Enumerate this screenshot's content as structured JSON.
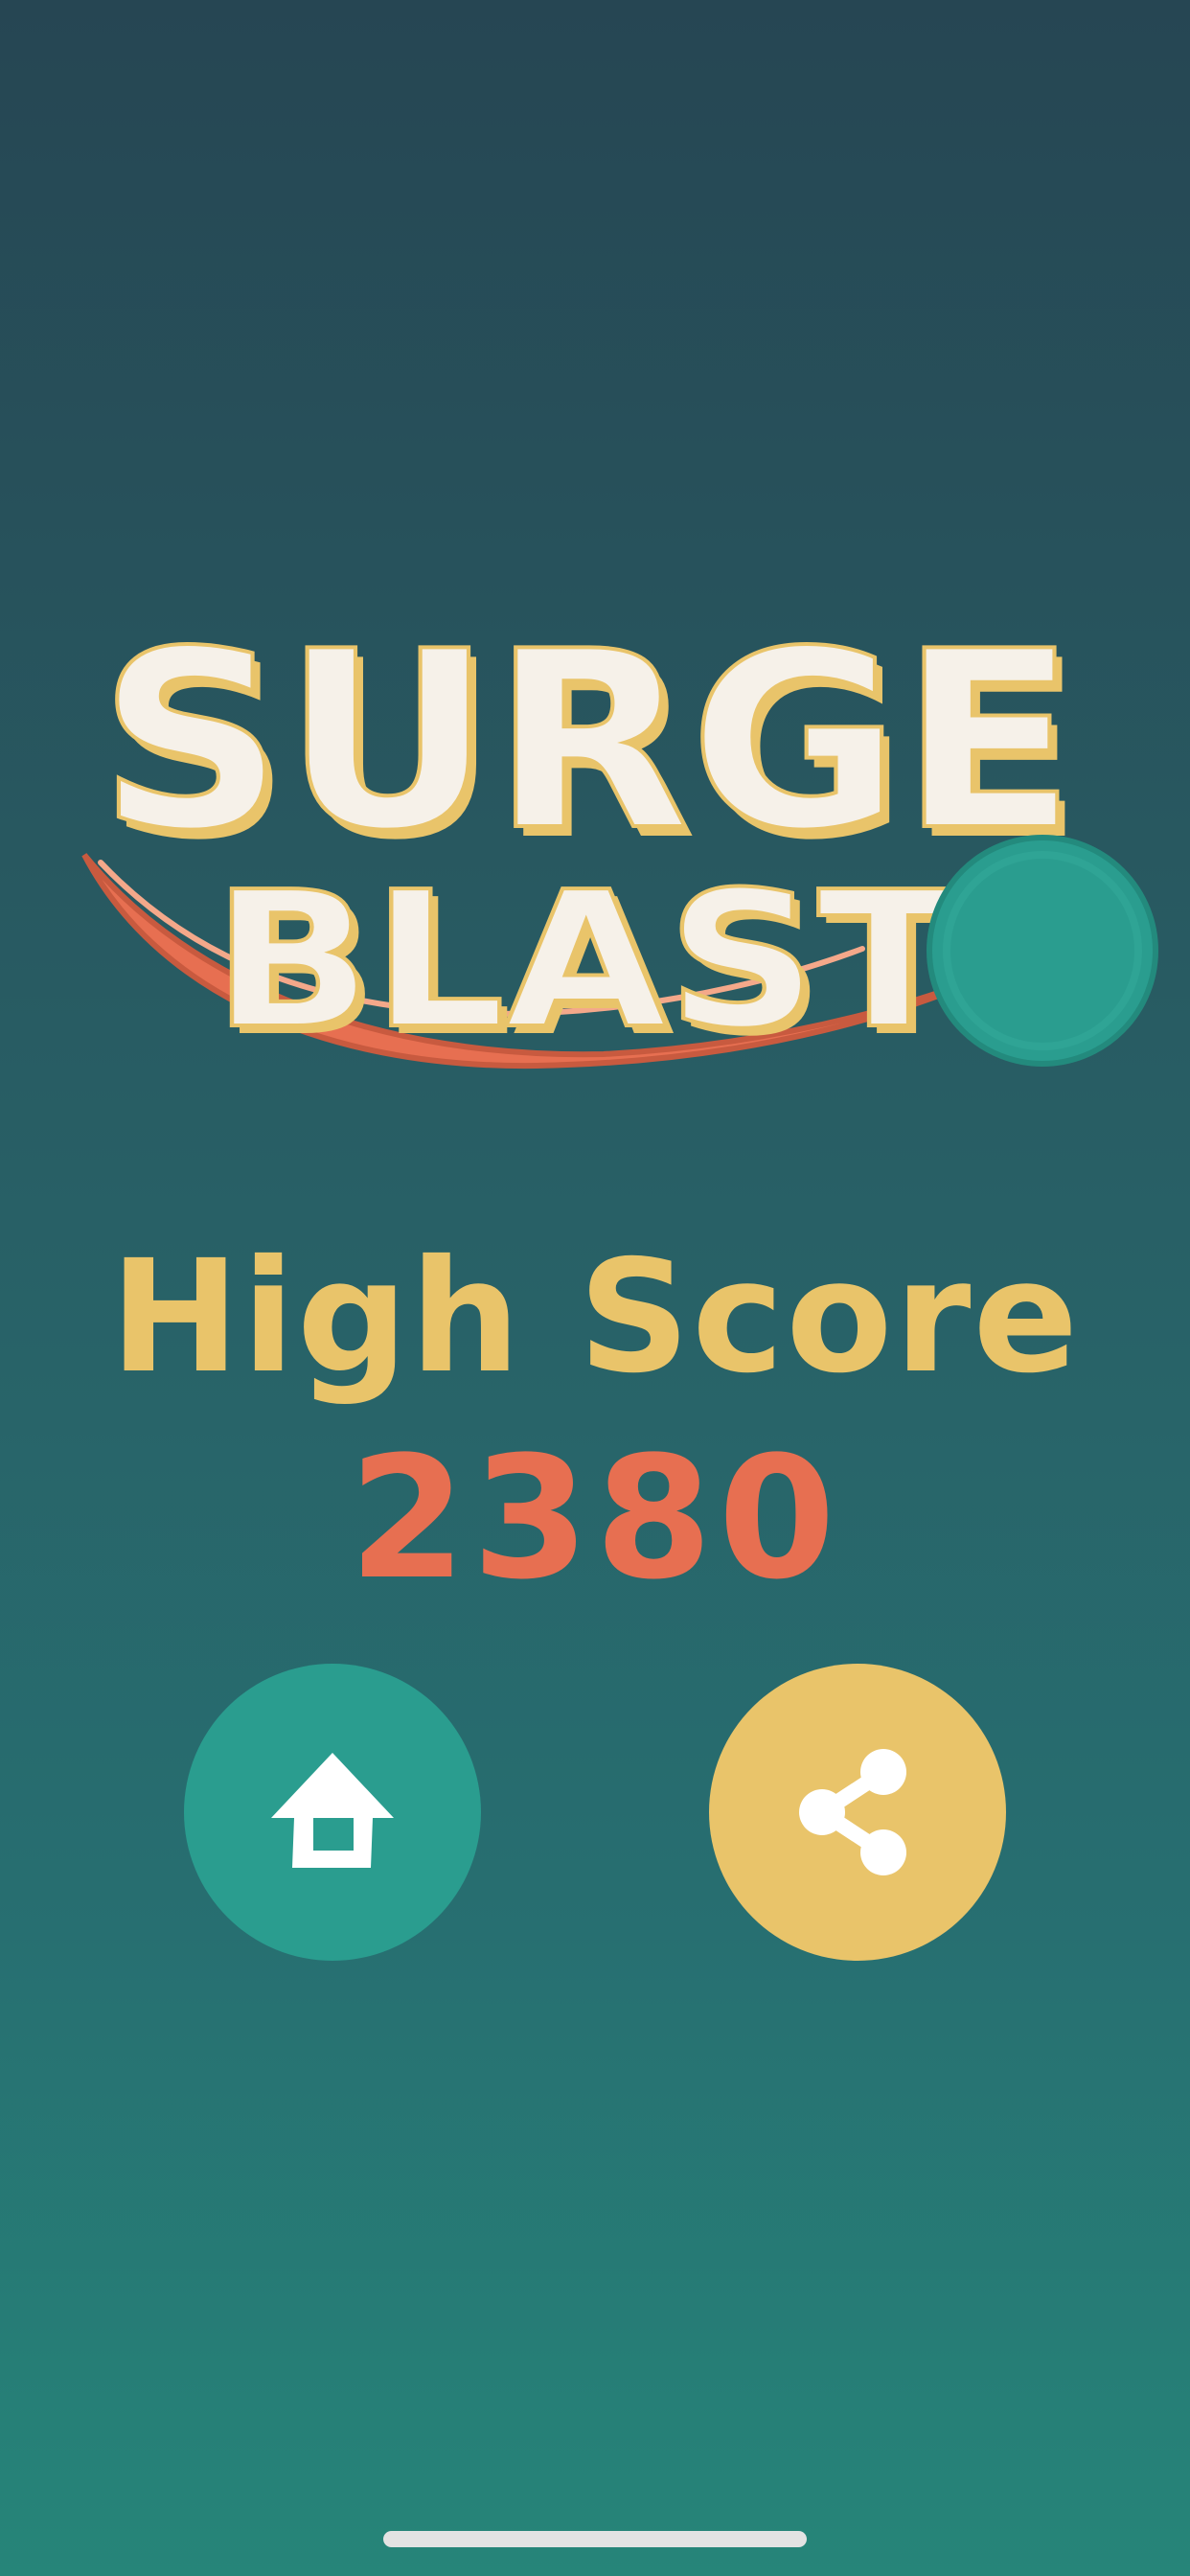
{
  "logo": {
    "line1": "SURGE",
    "line2": "BLAST"
  },
  "high_score": {
    "label": "High Score",
    "value": "2380"
  },
  "buttons": {
    "home_icon": "home-icon",
    "share_icon": "share-icon"
  },
  "colors": {
    "background_top": "#264653",
    "background_bottom": "#268579",
    "logo_text": "#f6f1e9",
    "logo_shadow": "#e9c46a",
    "swoosh": "#e76f51",
    "ball": "#2a9d8f",
    "label": "#e9c46a",
    "score": "#e76f51",
    "home_button": "#2a9d8f",
    "share_button": "#e9c46a",
    "icon": "#ffffff"
  }
}
